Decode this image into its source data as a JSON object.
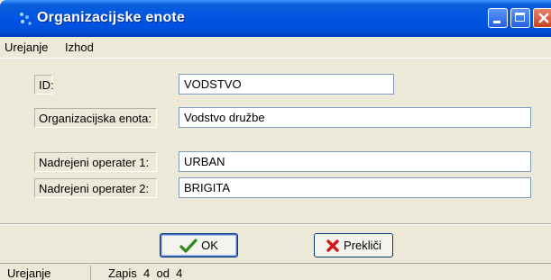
{
  "window": {
    "title": "Organizacijske enote"
  },
  "menu": {
    "items": [
      "Urejanje",
      "Izhod"
    ]
  },
  "form": {
    "id_label": "ID:",
    "id_value": "VODSTVO",
    "org_label": "Organizacijska enota:",
    "org_value": "Vodstvo družbe",
    "op1_label": "Nadrejeni operater 1:",
    "op1_value": "URBAN",
    "op2_label": "Nadrejeni operater 2:",
    "op2_value": "BRIGITA"
  },
  "buttons": {
    "ok_label": "OK",
    "cancel_label": "Prekliči"
  },
  "status": {
    "mode": "Urejanje",
    "record": "Zapis  4  od  4"
  },
  "icons": {
    "app": "app-icon",
    "ok": "checkmark-icon",
    "cancel": "x-icon"
  },
  "colors": {
    "titlebar": "#0054e3",
    "window_bg": "#ece9d8",
    "ok_icon": "#2a8a1a",
    "cancel_icon": "#d01818"
  }
}
